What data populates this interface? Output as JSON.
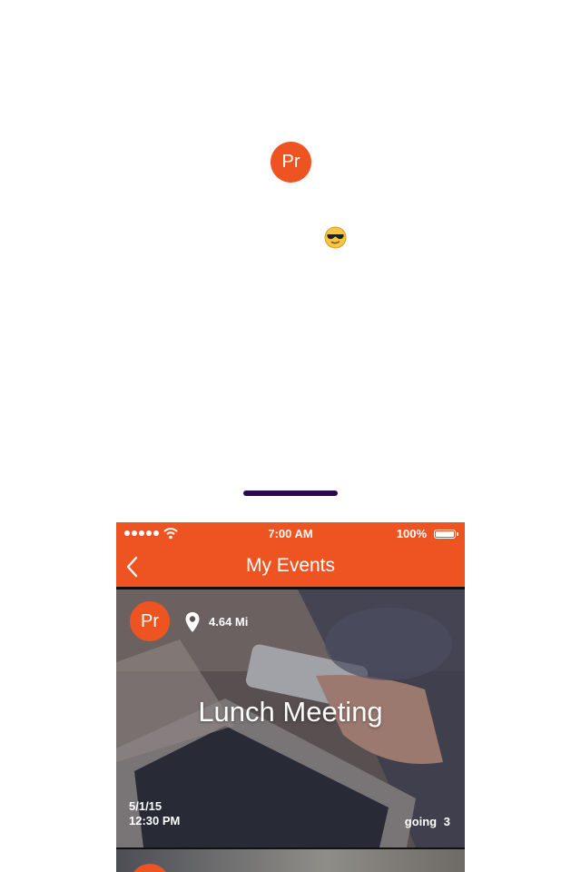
{
  "header": {
    "logo_text": "Pr",
    "emoji_icon": "sunglasses-emoji-icon"
  },
  "colors": {
    "accent": "#EE5422",
    "divider": "#2A0A4E"
  },
  "phone": {
    "status_bar": {
      "time": "7:00 AM",
      "battery_percent": "100%",
      "signal_icon": "signal-dots-icon",
      "wifi_icon": "wifi-icon",
      "battery_icon": "battery-icon"
    },
    "nav": {
      "title": "My Events",
      "back_icon": "chevron-left-icon"
    },
    "events": [
      {
        "avatar_text": "Pr",
        "distance": "4.64 Mi",
        "title": "Lunch Meeting",
        "date": "5/1/15",
        "time": "12:30 PM",
        "going_label": "going",
        "going_count": "3"
      }
    ]
  }
}
